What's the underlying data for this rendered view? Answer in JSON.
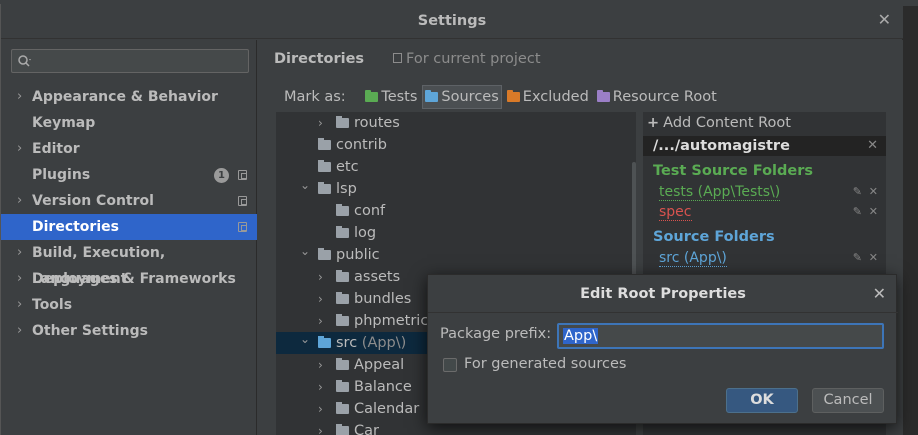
{
  "window": {
    "title": "Settings"
  },
  "sidebar": {
    "items": [
      {
        "label": "Appearance & Behavior",
        "expandable": true,
        "active": false
      },
      {
        "label": "Keymap",
        "expandable": false,
        "active": false
      },
      {
        "label": "Editor",
        "expandable": true,
        "active": false
      },
      {
        "label": "Plugins",
        "expandable": false,
        "active": false,
        "badge": "1"
      },
      {
        "label": "Version Control",
        "expandable": true,
        "active": false
      },
      {
        "label": "Directories",
        "expandable": false,
        "active": true
      },
      {
        "label": "Build, Execution, Deployment",
        "expandable": true,
        "active": false
      },
      {
        "label": "Languages & Frameworks",
        "expandable": true,
        "active": false
      },
      {
        "label": "Tools",
        "expandable": true,
        "active": false
      },
      {
        "label": "Other Settings",
        "expandable": true,
        "active": false
      }
    ]
  },
  "content": {
    "title": "Directories",
    "scope_label": "For current project",
    "mark_as": {
      "label": "Mark as:",
      "options": [
        {
          "label": "Tests",
          "color": "#5aab53",
          "active": false
        },
        {
          "label": "Sources",
          "color": "#5ea5d8",
          "active": true
        },
        {
          "label": "Excluded",
          "color": "#d97a28",
          "active": false
        },
        {
          "label": "Resource Root",
          "color": "#9b7fc7",
          "active": false
        }
      ]
    },
    "tree": [
      {
        "name": "routes",
        "depth": 1,
        "expand": "collapsed"
      },
      {
        "name": "contrib",
        "depth": 0,
        "expand": "none"
      },
      {
        "name": "etc",
        "depth": 0,
        "expand": "none"
      },
      {
        "name": "lsp",
        "depth": 0,
        "expand": "expanded"
      },
      {
        "name": "conf",
        "depth": 1,
        "expand": "none"
      },
      {
        "name": "log",
        "depth": 1,
        "expand": "none"
      },
      {
        "name": "public",
        "depth": 0,
        "expand": "expanded"
      },
      {
        "name": "assets",
        "depth": 1,
        "expand": "collapsed"
      },
      {
        "name": "bundles",
        "depth": 1,
        "expand": "collapsed"
      },
      {
        "name": "phpmetrics",
        "depth": 1,
        "expand": "collapsed"
      },
      {
        "name": "src",
        "pkg": " (App\\)",
        "depth": 0,
        "expand": "expanded",
        "selected": true,
        "source": true
      },
      {
        "name": "Appeal",
        "depth": 1,
        "expand": "collapsed"
      },
      {
        "name": "Balance",
        "depth": 1,
        "expand": "collapsed"
      },
      {
        "name": "Calendar",
        "depth": 1,
        "expand": "collapsed"
      },
      {
        "name": "Car",
        "depth": 1,
        "expand": "collapsed"
      }
    ],
    "roots": {
      "add_label": "Add Content Root",
      "path": "/.../automagistre",
      "test_heading": "Test Source Folders",
      "test_items": [
        {
          "label": "tests (App\\Tests\\)",
          "color": "#5aab53"
        },
        {
          "label": "spec",
          "color": "#d9534f"
        }
      ],
      "source_heading": "Source Folders",
      "source_items": [
        {
          "label": "src (App\\)",
          "color": "#5ea5d8"
        }
      ]
    }
  },
  "dialog": {
    "title": "Edit Root Properties",
    "prefix_label": "Package prefix:",
    "prefix_value": "App\\",
    "generated_label": "For generated sources",
    "generated_checked": false,
    "ok_label": "OK",
    "cancel_label": "Cancel"
  }
}
